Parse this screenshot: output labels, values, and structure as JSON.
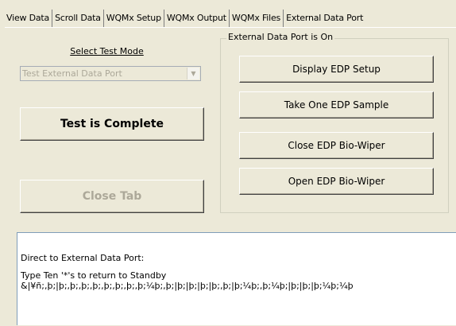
{
  "tabs": [
    "View Data",
    "Scroll Data",
    "WQMx Setup",
    "WQMx Output",
    "WQMx Files",
    "External Data Port"
  ],
  "test_mode": {
    "label": "Select Test Mode",
    "selected": "Test External Data Port"
  },
  "status_button": "Test is Complete",
  "close_tab_button": "Close Tab",
  "edp_group": {
    "title": "External Data Port is On",
    "buttons": [
      "Display EDP Setup",
      "Take One EDP Sample",
      "Close EDP Bio-Wiper",
      "Open EDP Bio-Wiper"
    ]
  },
  "console": {
    "line1": "Direct to External Data Port:",
    "line2": "Type Ten '*'s to return to Standby",
    "line3": "&|¥ñ;,þ;|þ;,þ;,þ;,þ;,þ;,þ;,þ;,þ;¼þ;,þ;|þ;|þ;|þ;|þ;,þ;|þ;¼þ;,þ;¼þ;|þ;|þ;|þ;¼þ;¼þ"
  }
}
